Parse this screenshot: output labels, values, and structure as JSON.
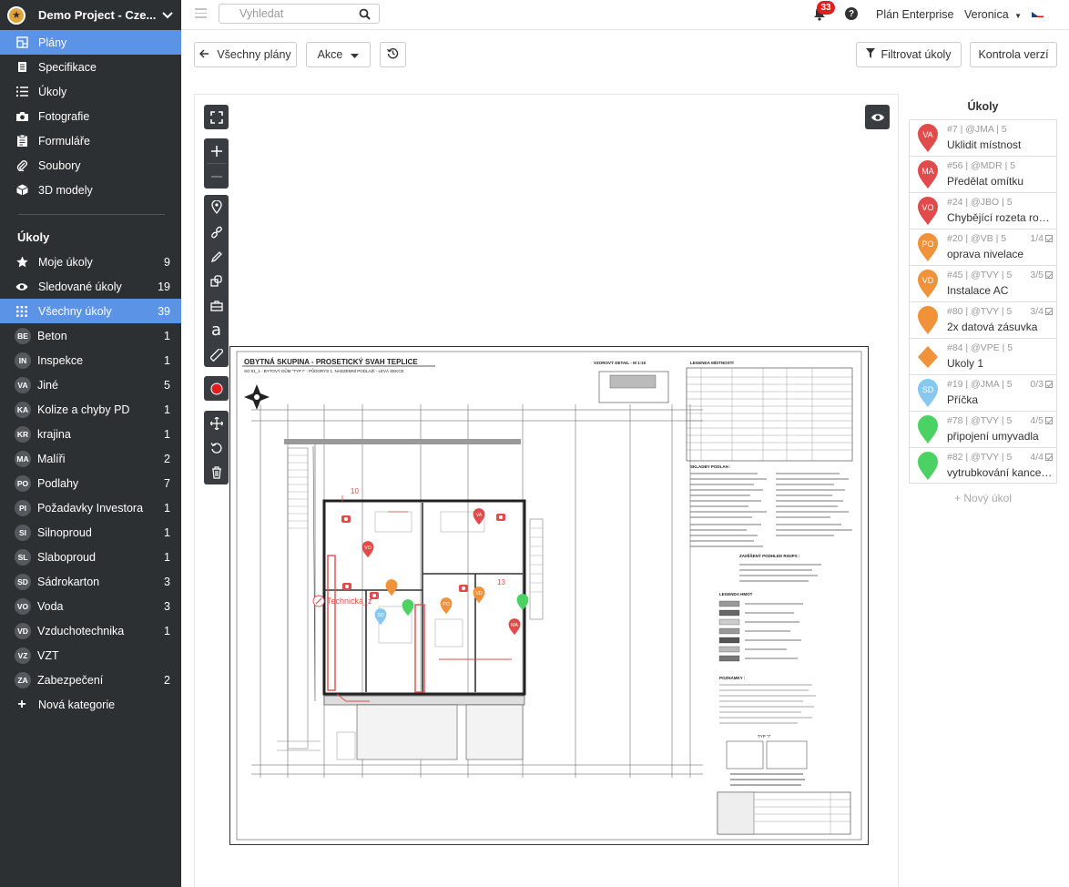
{
  "project": {
    "title": "Demo Project - Cze...",
    "logo_letter": "★"
  },
  "nav": [
    {
      "label": "Plány",
      "icon": "plans-icon",
      "active": true
    },
    {
      "label": "Specifikace",
      "icon": "spec-icon"
    },
    {
      "label": "Úkoly",
      "icon": "list-icon"
    },
    {
      "label": "Fotografie",
      "icon": "camera-icon"
    },
    {
      "label": "Formuláře",
      "icon": "clipboard-icon"
    },
    {
      "label": "Soubory",
      "icon": "paperclip-icon"
    },
    {
      "label": "3D modely",
      "icon": "cube-icon"
    }
  ],
  "tasks_section": {
    "title": "Úkoly",
    "filters": [
      {
        "label": "Moje úkoly",
        "count": "9",
        "icon": "star-icon"
      },
      {
        "label": "Sledované úkoly",
        "count": "19",
        "icon": "eye-icon"
      },
      {
        "label": "Všechny úkoly",
        "count": "39",
        "icon": "grid-icon",
        "active": true
      }
    ],
    "categories": [
      {
        "badge": "BE",
        "label": "Beton",
        "count": "1"
      },
      {
        "badge": "IN",
        "label": "Inspekce",
        "count": "1"
      },
      {
        "badge": "VA",
        "label": "Jiné",
        "count": "5"
      },
      {
        "badge": "KA",
        "label": "Kolize a chyby PD",
        "count": "1"
      },
      {
        "badge": "KR",
        "label": "krajina",
        "count": "1"
      },
      {
        "badge": "MA",
        "label": "Malíři",
        "count": "2"
      },
      {
        "badge": "PO",
        "label": "Podlahy",
        "count": "7"
      },
      {
        "badge": "PI",
        "label": "Požadavky Investora",
        "count": "1"
      },
      {
        "badge": "SI",
        "label": "Silnoproud",
        "count": "1"
      },
      {
        "badge": "SL",
        "label": "Slaboproud",
        "count": "1"
      },
      {
        "badge": "SD",
        "label": "Sádrokarton",
        "count": "3"
      },
      {
        "badge": "VO",
        "label": "Voda",
        "count": "3"
      },
      {
        "badge": "VD",
        "label": "Vzduchotechnika",
        "count": "1"
      },
      {
        "badge": "VZ",
        "label": "VZT",
        "count": ""
      },
      {
        "badge": "ZA",
        "label": "Zabezpečení",
        "count": "2"
      }
    ],
    "new_category": "Nová kategorie"
  },
  "topbar": {
    "search_placeholder": "Vyhledat",
    "notifications": "33",
    "help": "?",
    "plan": "Plán Enterprise",
    "user": "Veronica"
  },
  "toolbar": {
    "all_plans": "Všechny plány",
    "actions": "Akce",
    "filter": "Filtrovat úkoly",
    "version_check": "Kontrola verzí"
  },
  "colors": {
    "accent": "#5b93e6",
    "sidebar": "#2d3033",
    "red": "#e24b4b",
    "orange": "#f0923a",
    "green": "#4cd262",
    "lightblue": "#86c8ef"
  },
  "drawing": {
    "title": "OBYTNÁ SKUPINA - PROSETICKÝ SVAH TEPLICE",
    "subtitle": "SO 01_1 - BYTOVÝ DŮM \"TYP I\" - PŮDORYS 1. NADZEMNÍ PODLAŽÍ - LEVÁ SEKCE",
    "detail_title": "VZOROVÝ DETAIL - M 1:10",
    "legend_rooms": "LEGENDA MÍSTNOSTÍ",
    "floor_layers": "SKLADBY PODLAH :",
    "ceiling": "ZAVĚŠENÝ PODHLED RIGIPS :",
    "legend_materials": "LEGENDA HMOT",
    "notes": "POZNÁMKY :",
    "type_label": "TYP \"I\"",
    "room_label": "Technická_z"
  },
  "task_panel": {
    "title": "Úkoly",
    "tasks": [
      {
        "badge": "VA",
        "color": "#e24b4b",
        "meta": "#7 | @JMA | 5",
        "title": "Uklidit místnost",
        "progress": ""
      },
      {
        "badge": "MA",
        "color": "#e24b4b",
        "meta": "#56 | @MDR | 5",
        "title": "Předělat omítku",
        "progress": ""
      },
      {
        "badge": "VO",
        "color": "#e24b4b",
        "meta": "#24 | @JBO | 5",
        "title": "Chybějící rozeta roháč...",
        "progress": ""
      },
      {
        "badge": "PO",
        "color": "#f0923a",
        "meta": "#20 | @VB | 5",
        "title": "oprava nivelace",
        "progress": "1/4"
      },
      {
        "badge": "VD",
        "color": "#f0923a",
        "meta": "#45 | @TVY | 5",
        "title": "Instalace AC",
        "progress": "3/5"
      },
      {
        "badge": "",
        "color": "#f0923a",
        "meta": "#80 | @TVY | 5",
        "title": "2x datová zásuvka",
        "progress": "3/4"
      },
      {
        "badge": "",
        "color": "#f0923a",
        "meta": "#84 | @VPE | 5",
        "title": "Ukoly 1",
        "progress": "",
        "shape": "diamond"
      },
      {
        "badge": "SD",
        "color": "#86c8ef",
        "meta": "#19 | @JMA | 5",
        "title": "Příčka",
        "progress": "0/3"
      },
      {
        "badge": "",
        "color": "#4cd262",
        "meta": "#78 | @TVY | 5",
        "title": "připojení umyvadla",
        "progress": "4/5"
      },
      {
        "badge": "",
        "color": "#4cd262",
        "meta": "#82 | @TVY | 5",
        "title": "vytrubkování kancelář...",
        "progress": "4/4"
      }
    ],
    "new_task": "+ Nový úkol"
  }
}
